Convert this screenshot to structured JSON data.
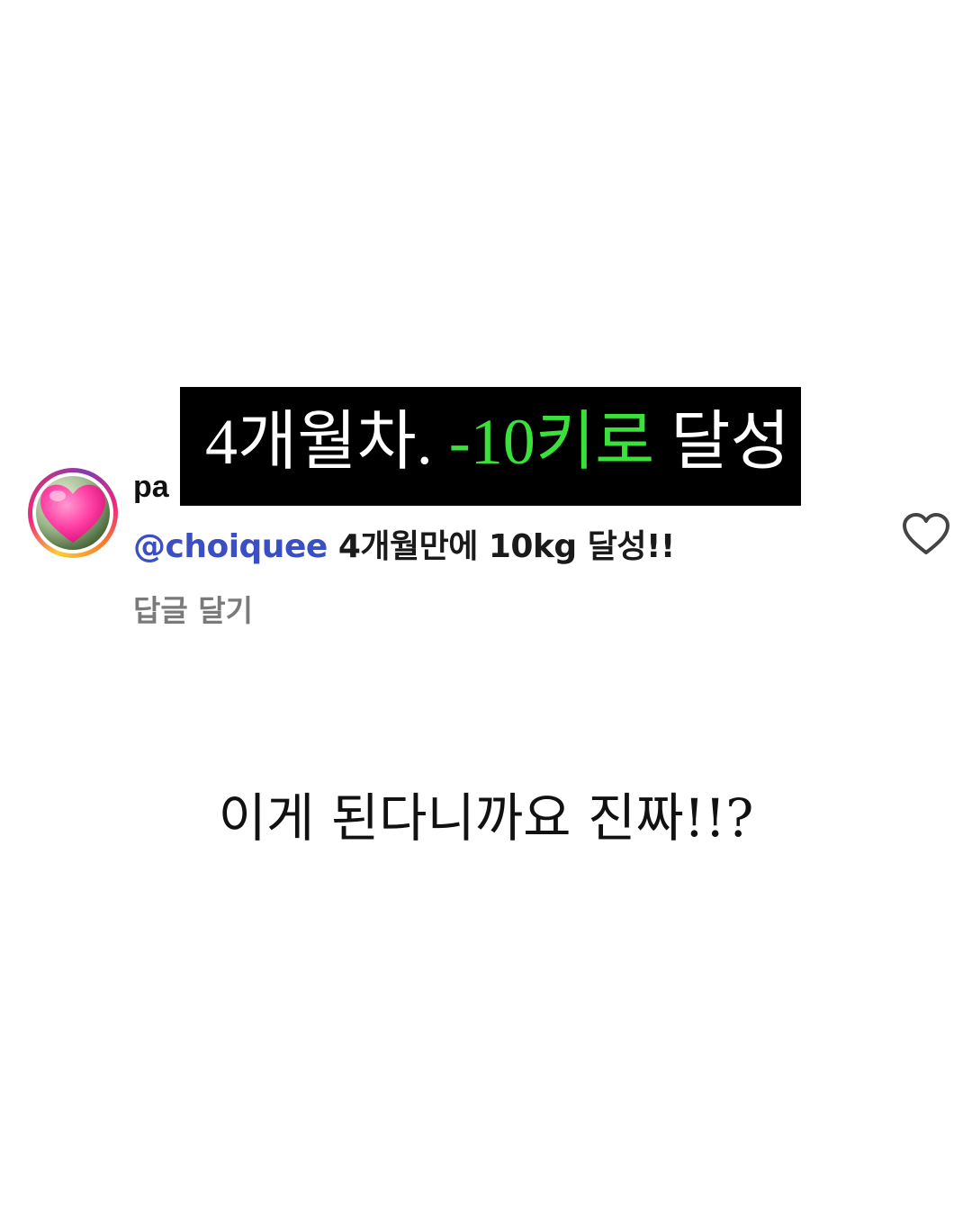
{
  "comment": {
    "username": "pa",
    "mention": "@choiquee",
    "text": " 4개월만에 10kg 달성!!",
    "reply_label": "답글 달기",
    "avatar_icon": "heart-emoji-icon",
    "like_icon": "heart-outline-icon"
  },
  "overlay_banner": {
    "text_prefix": "4개월차. ",
    "text_accent": "-10키로",
    "text_suffix": " 달성",
    "accent_color": "#3be13b"
  },
  "caption": {
    "text": "이게 된다니까요 진짜!!?"
  }
}
